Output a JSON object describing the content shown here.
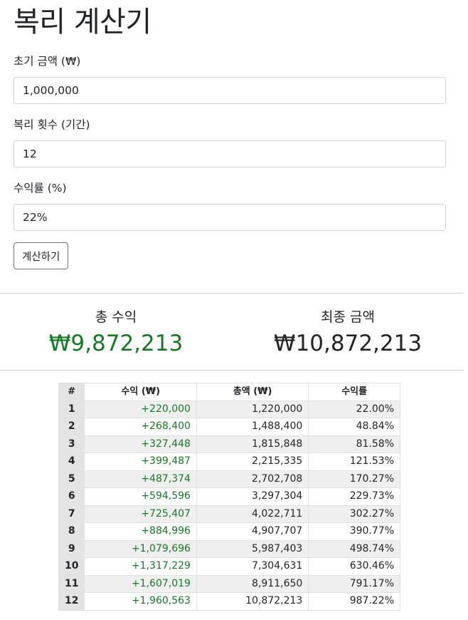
{
  "page_title": "복리 계산기",
  "form": {
    "principal_label": "초기 금액 (₩)",
    "principal_value": "1,000,000",
    "periods_label": "복리 횟수 (기간)",
    "periods_value": "12",
    "rate_label": "수익률 (%)",
    "rate_value": "22%",
    "calculate_button": "계산하기"
  },
  "summary": {
    "total_profit_label": "총 수익",
    "total_profit_value": "₩9,872,213",
    "final_amount_label": "최종 금액",
    "final_amount_value": "₩10,872,213"
  },
  "colors": {
    "profit": "#157a24",
    "index_column": "#e4e4e4",
    "row_stripe": "#efefef"
  },
  "table": {
    "headers": [
      "#",
      "수익 (₩)",
      "총액 (₩)",
      "수익률"
    ],
    "rows": [
      {
        "period": "1",
        "gain": "+220,000",
        "total": "1,220,000",
        "rate": "22.00%"
      },
      {
        "period": "2",
        "gain": "+268,400",
        "total": "1,488,400",
        "rate": "48.84%"
      },
      {
        "period": "3",
        "gain": "+327,448",
        "total": "1,815,848",
        "rate": "81.58%"
      },
      {
        "period": "4",
        "gain": "+399,487",
        "total": "2,215,335",
        "rate": "121.53%"
      },
      {
        "period": "5",
        "gain": "+487,374",
        "total": "2,702,708",
        "rate": "170.27%"
      },
      {
        "period": "6",
        "gain": "+594,596",
        "total": "3,297,304",
        "rate": "229.73%"
      },
      {
        "period": "7",
        "gain": "+725,407",
        "total": "4,022,711",
        "rate": "302.27%"
      },
      {
        "period": "8",
        "gain": "+884,996",
        "total": "4,907,707",
        "rate": "390.77%"
      },
      {
        "period": "9",
        "gain": "+1,079,696",
        "total": "5,987,403",
        "rate": "498.74%"
      },
      {
        "period": "10",
        "gain": "+1,317,229",
        "total": "7,304,631",
        "rate": "630.46%"
      },
      {
        "period": "11",
        "gain": "+1,607,019",
        "total": "8,911,650",
        "rate": "791.17%"
      },
      {
        "period": "12",
        "gain": "+1,960,563",
        "total": "10,872,213",
        "rate": "987.22%"
      }
    ]
  }
}
